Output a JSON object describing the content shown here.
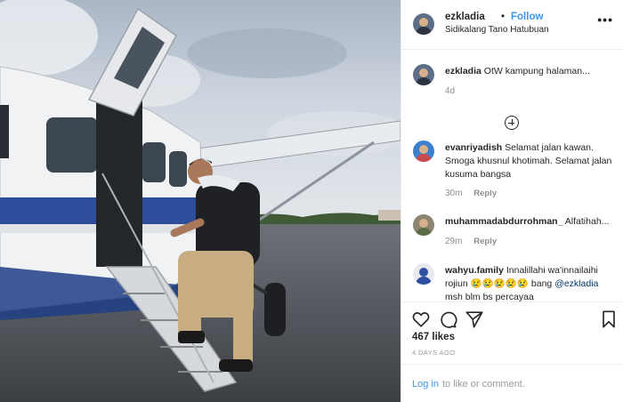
{
  "post": {
    "username": "ezkladia",
    "separator": "•",
    "follow_label": "Follow",
    "location": "Sidikalang Tano Hatubuan",
    "more_icon": "more-options-icon"
  },
  "caption": {
    "username": "ezkladia",
    "text": "OtW kampung halaman...",
    "time": "4d"
  },
  "comments": [
    {
      "username": "evanriyadish",
      "text": "Selamat jalan kawan. Smoga khusnul khotimah. Selamat jalan kusuma bangsa",
      "time": "30m",
      "reply": "Reply"
    },
    {
      "username": "muhammadabdurrohman_",
      "text": "Alfatihah...",
      "time": "29m",
      "reply": "Reply"
    },
    {
      "username": "wahyu.family",
      "text_before": "Innalillahi wa'innailaihi rojiun",
      "emojis": "😢😢😢😢😢",
      "text_mid": "bang",
      "mention": "@ezkladia",
      "text_after": "msh blm bs percayaa"
    }
  ],
  "actions": {
    "like_icon": "heart-icon",
    "comment_icon": "comment-icon",
    "share_icon": "share-icon",
    "save_icon": "bookmark-icon"
  },
  "likes": "467 likes",
  "posted_ago": "4 DAYS AGO",
  "footer": {
    "login": "Log in",
    "rest": "to like or comment."
  },
  "colors": {
    "link": "#3897f0",
    "mention": "#003569",
    "muted": "#8e8e8e"
  }
}
